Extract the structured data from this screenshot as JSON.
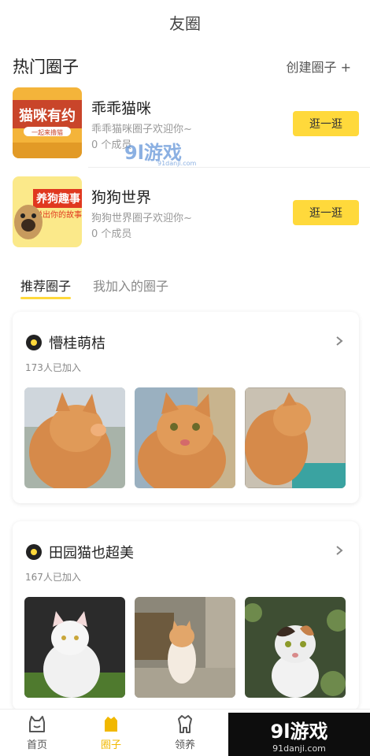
{
  "header": {
    "title": "友圈"
  },
  "hot": {
    "heading": "热门圈子",
    "create_label": "创建圈子 +",
    "items": [
      {
        "name": "乖乖猫咪",
        "desc": "乖乖猫咪圈子欢迎你~",
        "members": "0 个成员",
        "button": "逛一逛",
        "thumb_text_1": "猫咪有约",
        "thumb_text_2": "一起来撸猫"
      },
      {
        "name": "狗狗世界",
        "desc": "狗狗世界圈子欢迎你~",
        "members": "0 个成员",
        "button": "逛一逛",
        "thumb_text_1": "养狗趣事",
        "thumb_text_2": "说出你的故事"
      }
    ]
  },
  "tabs": [
    {
      "label": "推荐圈子",
      "active": true
    },
    {
      "label": "我加入的圈子",
      "active": false
    }
  ],
  "cards": [
    {
      "title": "懵桂萌桔",
      "joined": "173人已加入"
    },
    {
      "title": "田园猫也超美",
      "joined": "167人已加入"
    }
  ],
  "tabbar": [
    {
      "label": "首页",
      "icon": "cat-home-icon",
      "active": false
    },
    {
      "label": "圈子",
      "icon": "circle-icon",
      "active": true
    },
    {
      "label": "领养",
      "icon": "adopt-icon",
      "active": false
    }
  ],
  "watermark": {
    "brand": "9l游戏",
    "url": "91danji.com"
  },
  "colors": {
    "accent": "#ffd93b",
    "active_tab": "#f1b800"
  }
}
